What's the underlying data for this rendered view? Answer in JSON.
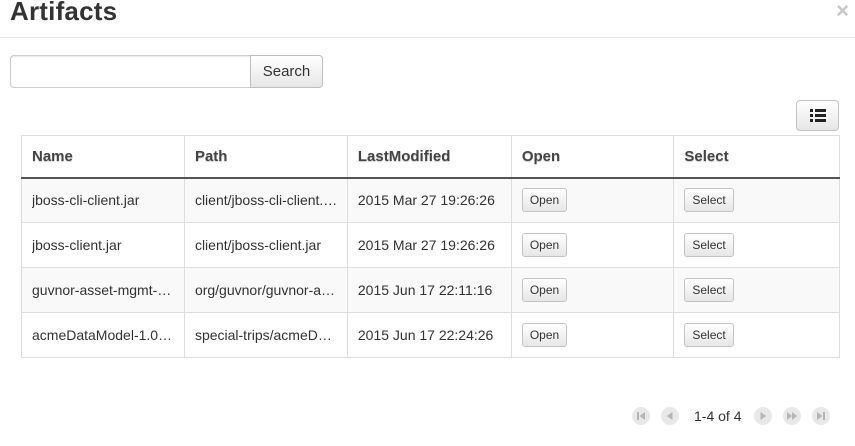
{
  "dialog": {
    "title": "Artifacts",
    "close_glyph": "×"
  },
  "search": {
    "value": "",
    "placeholder": "",
    "button_label": "Search"
  },
  "toolbar": {
    "list_icon": "list-icon"
  },
  "table": {
    "columns": [
      "Name",
      "Path",
      "LastModified",
      "Open",
      "Select"
    ],
    "rows": [
      {
        "name": "jboss-cli-client.jar",
        "path": "client/jboss-cli-client.…",
        "modified": "2015 Mar 27 19:26:26",
        "open_label": "Open",
        "select_label": "Select"
      },
      {
        "name": "jboss-client.jar",
        "path": "client/jboss-client.jar",
        "modified": "2015 Mar 27 19:26:26",
        "open_label": "Open",
        "select_label": "Select"
      },
      {
        "name": "guvnor-asset-mgmt-…",
        "path": "org/guvnor/guvnor-a…",
        "modified": "2015 Jun 17 22:11:16",
        "open_label": "Open",
        "select_label": "Select"
      },
      {
        "name": "acmeDataModel-1.0…",
        "path": "special-trips/acmeD…",
        "modified": "2015 Jun 17 22:24:26",
        "open_label": "Open",
        "select_label": "Select"
      }
    ]
  },
  "pager": {
    "range_text": "1-4 of 4",
    "icons": [
      "first-page-icon",
      "prev-page-icon",
      "next-page-icon",
      "fast-forward-icon",
      "last-page-icon"
    ]
  },
  "colors": {
    "header_border": "#555555",
    "stripe": "#f9f9f9",
    "pager_disabled": "#b5b5b5"
  }
}
